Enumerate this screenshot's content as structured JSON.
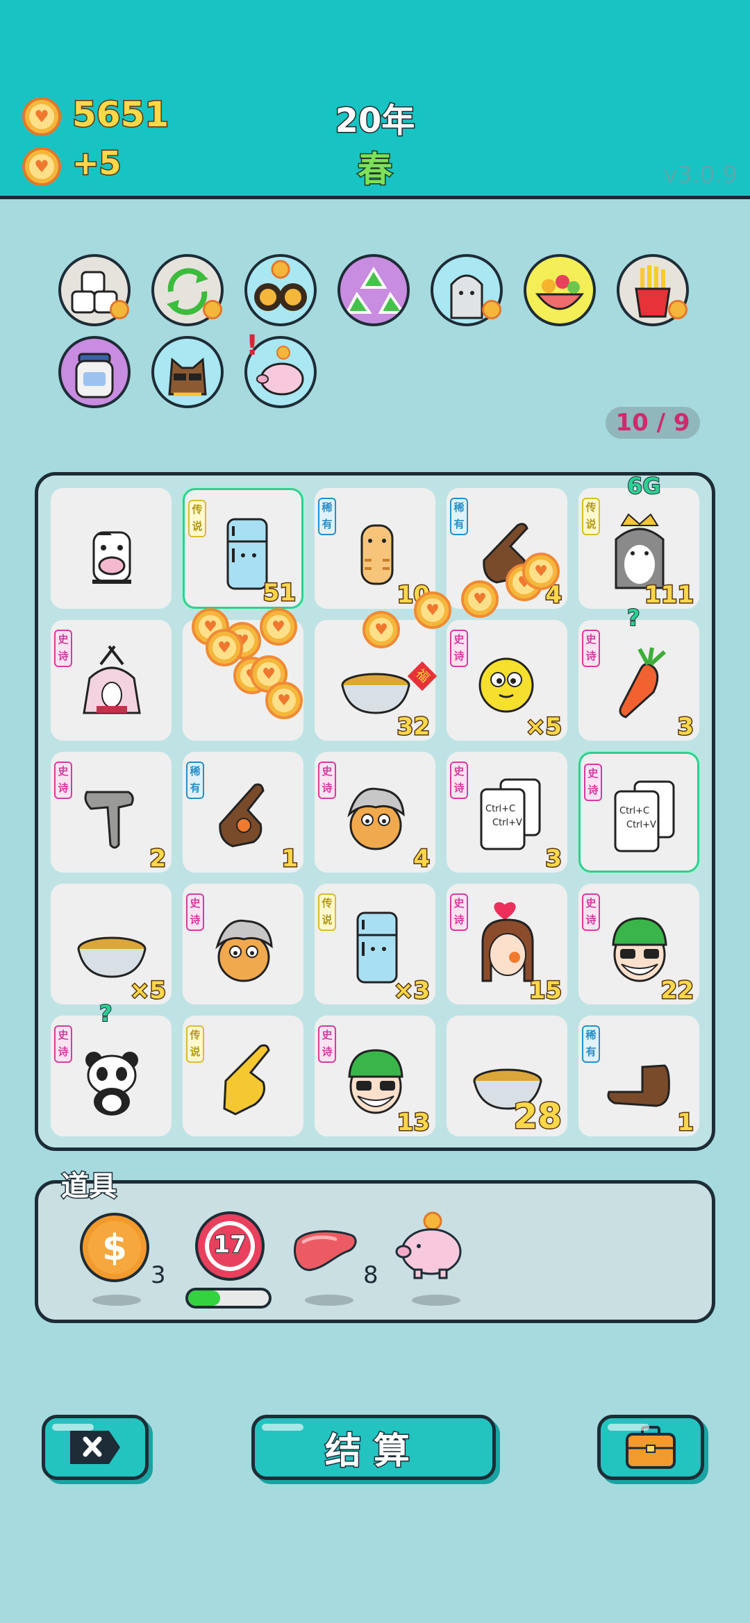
{
  "header": {
    "coins": "5651",
    "income": "+5",
    "year": "20年",
    "season": "春",
    "version": "v3.0.9"
  },
  "relics": [
    {
      "icon": "sugar-cubes-icon",
      "bg": "#e6e3dc",
      "coin": true
    },
    {
      "icon": "recycle-arrows-icon",
      "bg": "#e6e3dc",
      "coin": true
    },
    {
      "icon": "coin-owls-icon",
      "bg": "#a9e7f2",
      "coin": false
    },
    {
      "icon": "recycle-symbol-icon",
      "bg": "#c88ce0",
      "coin": false
    },
    {
      "icon": "husky-icon",
      "bg": "#a9e7f2",
      "coin": true
    },
    {
      "icon": "fruit-bowl-icon",
      "bg": "#f4ee57",
      "coin": false
    },
    {
      "icon": "french-fries-icon",
      "bg": "#e6e3dc",
      "coin": true
    },
    {
      "icon": "jar-icon",
      "bg": "#c88ce0",
      "coin": false
    },
    {
      "icon": "sunglasses-dog-icon",
      "bg": "#a9e7f2",
      "coin": false
    },
    {
      "icon": "piggy-bank-icon",
      "bg": "#a9e7f2",
      "coin": false
    }
  ],
  "relic_alert": "!",
  "counter": "10 / 9",
  "board": [
    {
      "tag": "",
      "tag_type": "",
      "art": "cow-icon",
      "count": "",
      "selected": false
    },
    {
      "tag": "传说",
      "tag_type": "legend",
      "art": "fridge-icon",
      "count": "51",
      "selected": true
    },
    {
      "tag": "稀有",
      "tag_type": "rare",
      "art": "tiger-icon",
      "count": "10",
      "selected": false
    },
    {
      "tag": "稀有",
      "tag_type": "rare",
      "art": "pointing-hand-icon",
      "count": "4",
      "selected": false
    },
    {
      "tag": "传说",
      "tag_type": "legend",
      "art": "crowned-husky-icon",
      "count": "111",
      "selected": false,
      "top_label": "6G"
    },
    {
      "tag": "史诗",
      "tag_type": "epic",
      "art": "bunny-house-icon",
      "count": "",
      "selected": false
    },
    {
      "tag": "",
      "tag_type": "",
      "art": "empty",
      "count": "",
      "selected": false
    },
    {
      "tag": "",
      "tag_type": "",
      "art": "soup-bowl-icon",
      "count": "32",
      "selected": false,
      "badge": "福"
    },
    {
      "tag": "史诗",
      "tag_type": "epic",
      "art": "yellow-chick-icon",
      "count": "×5",
      "selected": false
    },
    {
      "tag": "史诗",
      "tag_type": "epic",
      "art": "carrot-icon",
      "count": "3",
      "selected": false,
      "top_label": "?"
    },
    {
      "tag": "史诗",
      "tag_type": "epic",
      "art": "grey-hand-icon",
      "count": "2",
      "selected": false
    },
    {
      "tag": "稀有",
      "tag_type": "rare",
      "art": "basketball-hand-icon",
      "count": "1",
      "selected": false
    },
    {
      "tag": "史诗",
      "tag_type": "epic",
      "art": "silver-hair-bird-icon",
      "count": "4",
      "selected": false
    },
    {
      "tag": "史诗",
      "tag_type": "epic",
      "art": "copy-paste-icon",
      "count": "3",
      "selected": false
    },
    {
      "tag": "史诗",
      "tag_type": "epic",
      "art": "copy-paste-icon",
      "count": "",
      "selected": true
    },
    {
      "tag": "",
      "tag_type": "",
      "art": "soup-bowl-icon",
      "count": "×5",
      "selected": false
    },
    {
      "tag": "史诗",
      "tag_type": "epic",
      "art": "silver-hair-bird-icon",
      "count": "",
      "selected": false
    },
    {
      "tag": "传说",
      "tag_type": "legend",
      "art": "fridge-icon",
      "count": "×3",
      "selected": false
    },
    {
      "tag": "史诗",
      "tag_type": "epic",
      "art": "braided-girl-icon",
      "count": "15",
      "selected": false
    },
    {
      "tag": "史诗",
      "tag_type": "epic",
      "art": "green-hat-man-icon",
      "count": "22",
      "selected": false
    },
    {
      "tag": "史诗",
      "tag_type": "epic",
      "art": "panda-icon",
      "count": "",
      "selected": false,
      "top_label": "?"
    },
    {
      "tag": "传说",
      "tag_type": "legend",
      "art": "yellow-hand-icon",
      "count": "",
      "selected": false
    },
    {
      "tag": "史诗",
      "tag_type": "epic",
      "art": "green-hat-man-icon",
      "count": "13",
      "selected": false
    },
    {
      "tag": "",
      "tag_type": "",
      "art": "soup-bowl-icon",
      "count": "28",
      "selected": false,
      "big": true
    },
    {
      "tag": "稀有",
      "tag_type": "rare",
      "art": "flat-hand-icon",
      "count": "1",
      "selected": false
    }
  ],
  "items": {
    "label": "道具",
    "list": [
      {
        "icon": "dollar-coin-icon",
        "count": "3"
      },
      {
        "icon": "target-icon",
        "value": "17",
        "progress": 0.4
      },
      {
        "icon": "liver-icon",
        "count": "8"
      },
      {
        "icon": "piggy-bank-icon",
        "count": ""
      }
    ]
  },
  "buttons": {
    "settle": "结算"
  },
  "colors": {
    "header": "#17c4c3",
    "background": "#a6dade",
    "button": "#23c3c0",
    "epic": "#d63ba0",
    "rare": "#278ec9",
    "legend": "#d8bd2c"
  }
}
